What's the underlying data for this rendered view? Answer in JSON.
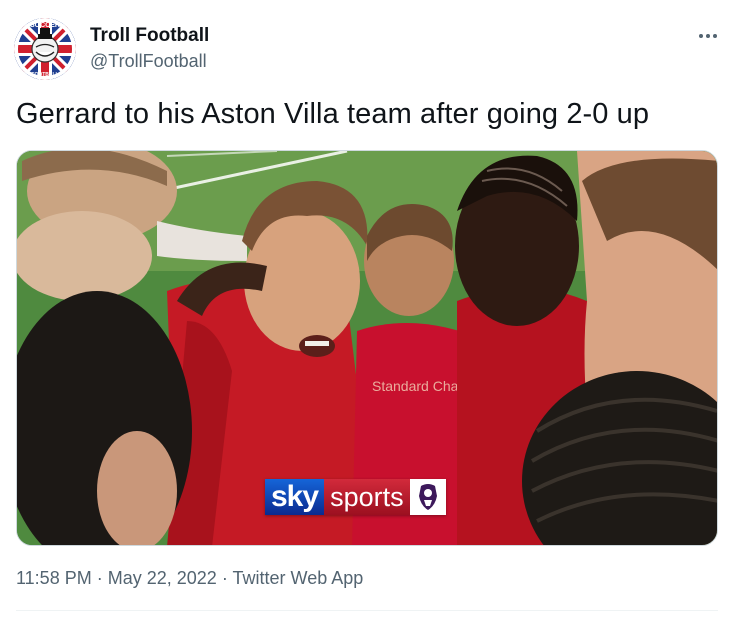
{
  "author": {
    "name": "Troll Football",
    "handle": "@TrollFootball",
    "avatar_icon": "troll-face-union-jack-avatar",
    "avatar_text_top": "SOCCER",
    "avatar_text_bottom": "FOOTBALL"
  },
  "tweet": {
    "text": "Gerrard to his Aston Villa team after going 2-0 up"
  },
  "media": {
    "description_icon": "players-huddle-photo",
    "jersey_text_left": "Standard Chartered",
    "broadcaster_logo": {
      "sky": "sky",
      "sports": "sports",
      "league_icon": "premier-league-lion-icon"
    }
  },
  "meta": {
    "time": "11:58 PM",
    "separator": "·",
    "date": "May 22, 2022",
    "source": "Twitter Web App"
  },
  "more_icon": "more-options-icon",
  "colors": {
    "text_primary": "#0f1419",
    "text_secondary": "#536471",
    "border": "#cfd9de",
    "kit_red": "#c8102e",
    "pitch_green": "#3c7a3a"
  }
}
